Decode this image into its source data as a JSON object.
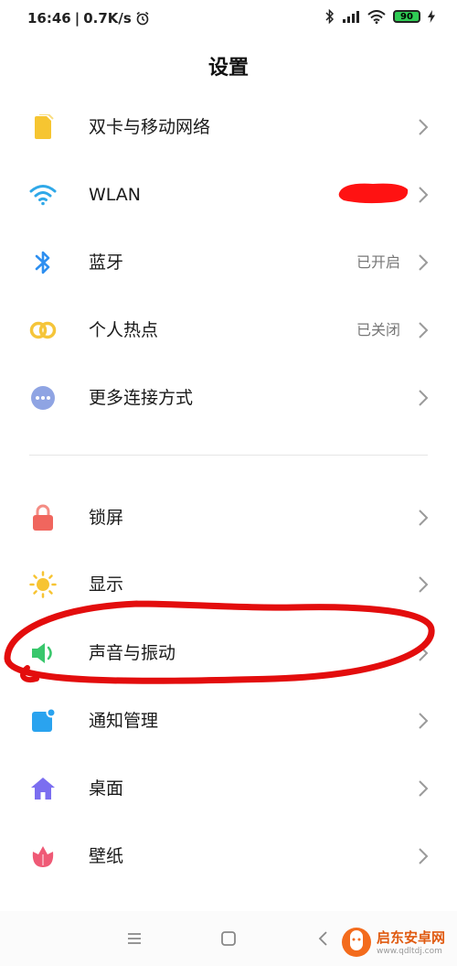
{
  "status": {
    "time": "16:46",
    "speed": "0.7K/s",
    "battery": "90",
    "icons": [
      "alarm-icon",
      "bluetooth-icon",
      "signal-icon",
      "wifi-icon",
      "battery-icon",
      "charging-icon"
    ]
  },
  "title": "设置",
  "groups": [
    {
      "items": [
        {
          "label": "双卡与移动网络",
          "value": "",
          "icon": "sim-card-icon",
          "color": "#f6c531"
        },
        {
          "label": "WLAN",
          "value": "",
          "icon": "wifi-icon",
          "color": "#2fa8e8"
        },
        {
          "label": "蓝牙",
          "value": "已开启",
          "icon": "bluetooth-icon",
          "color": "#2e8ff0"
        },
        {
          "label": "个人热点",
          "value": "已关闭",
          "icon": "hotspot-icon",
          "color": "#f5c53a"
        },
        {
          "label": "更多连接方式",
          "value": "",
          "icon": "more-icon",
          "color": "#8fa4e3"
        }
      ]
    },
    {
      "items": [
        {
          "label": "锁屏",
          "value": "",
          "icon": "lock-icon",
          "color": "#f0665e"
        },
        {
          "label": "显示",
          "value": "",
          "icon": "sun-icon",
          "color": "#f7c433"
        },
        {
          "label": "声音与振动",
          "value": "",
          "icon": "speaker-icon",
          "color": "#39c76c"
        },
        {
          "label": "通知管理",
          "value": "",
          "icon": "notification-icon",
          "color": "#2aa3ef"
        },
        {
          "label": "桌面",
          "value": "",
          "icon": "home-icon",
          "color": "#7b6ef0"
        },
        {
          "label": "壁纸",
          "value": "",
          "icon": "wallpaper-icon",
          "color": "#ef5a76"
        }
      ]
    }
  ],
  "navbar": {
    "icons": [
      "menu-icon",
      "home-square-icon",
      "back-icon"
    ]
  },
  "watermark": {
    "name": "启东安卓网",
    "url": "www.qdltdj.com"
  }
}
